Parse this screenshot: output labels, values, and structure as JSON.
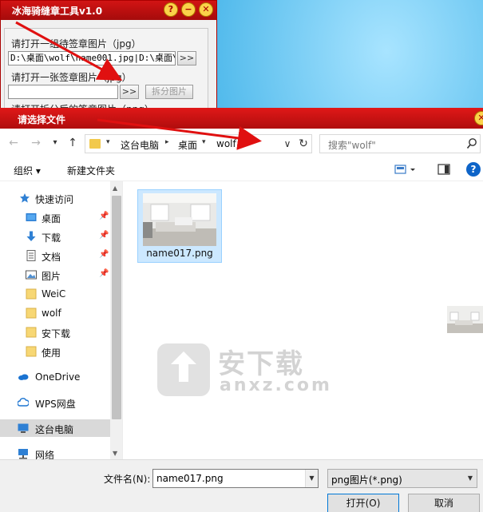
{
  "app": {
    "title": "冰海骑缝章工具v1.0",
    "window_buttons": [
      "?",
      "−",
      "✕"
    ],
    "label_multi": "请打开一组待签章图片（jpg）",
    "multi_input_value": "D:\\桌面\\wolf\\name001.jpg|D:\\桌面\\w",
    "browse_label": ">>",
    "label_single": "请打开一张签章图片（jpg）",
    "single_input_value": "",
    "split_button": "拆分图片",
    "label_output": "请打开拆分后的签章图片（png）"
  },
  "dialog": {
    "title": "请选择文件",
    "close": "✕",
    "nav": {
      "back": "←",
      "forward": "→",
      "recent": "▾",
      "up": "↑",
      "refresh": "↻",
      "dropdown": "∨"
    },
    "address": {
      "segments": [
        "这台电脑",
        "桌面",
        "wolf"
      ],
      "separator": "▸",
      "separator_after_desktop": "▾"
    },
    "search": {
      "placeholder": "搜索\"wolf\""
    },
    "commands": {
      "organize": "组织 ▾",
      "new_folder": "新建文件夹",
      "help": "?"
    },
    "sidebar": {
      "items": [
        {
          "label": "快速访问",
          "icon": "star-icon",
          "pinned": false
        },
        {
          "label": "桌面",
          "icon": "desktop-icon",
          "pinned": true
        },
        {
          "label": "下载",
          "icon": "download-icon",
          "pinned": true
        },
        {
          "label": "文档",
          "icon": "document-icon",
          "pinned": true
        },
        {
          "label": "图片",
          "icon": "picture-icon",
          "pinned": true
        },
        {
          "label": "WeiC",
          "icon": "folder-icon",
          "pinned": false
        },
        {
          "label": "wolf",
          "icon": "folder-icon",
          "pinned": false
        },
        {
          "label": "安下载",
          "icon": "folder-icon",
          "pinned": false
        },
        {
          "label": "使用",
          "icon": "folder-icon",
          "pinned": false
        },
        {
          "label": "OneDrive",
          "icon": "cloud-icon",
          "pinned": false
        },
        {
          "label": "WPS网盘",
          "icon": "wps-cloud-icon",
          "pinned": false
        },
        {
          "label": "这台电脑",
          "icon": "computer-icon",
          "pinned": false,
          "selected": true
        },
        {
          "label": "网络",
          "icon": "network-icon",
          "pinned": false
        }
      ],
      "pin_glyph": "📌"
    },
    "files": [
      {
        "name": "name017.png",
        "selected": true
      }
    ],
    "watermark": {
      "text": "安下载",
      "sub": "anxz.com"
    },
    "bottom": {
      "filename_label": "文件名(N):",
      "filename_value": "name017.png",
      "filetype_value": "png图片(*.png)",
      "open_button": "打开(O)",
      "cancel_button": "取消"
    }
  },
  "colors": {
    "title_red": "#c81010",
    "selection_blue": "#cce8ff",
    "accent_blue": "#0078d7"
  }
}
